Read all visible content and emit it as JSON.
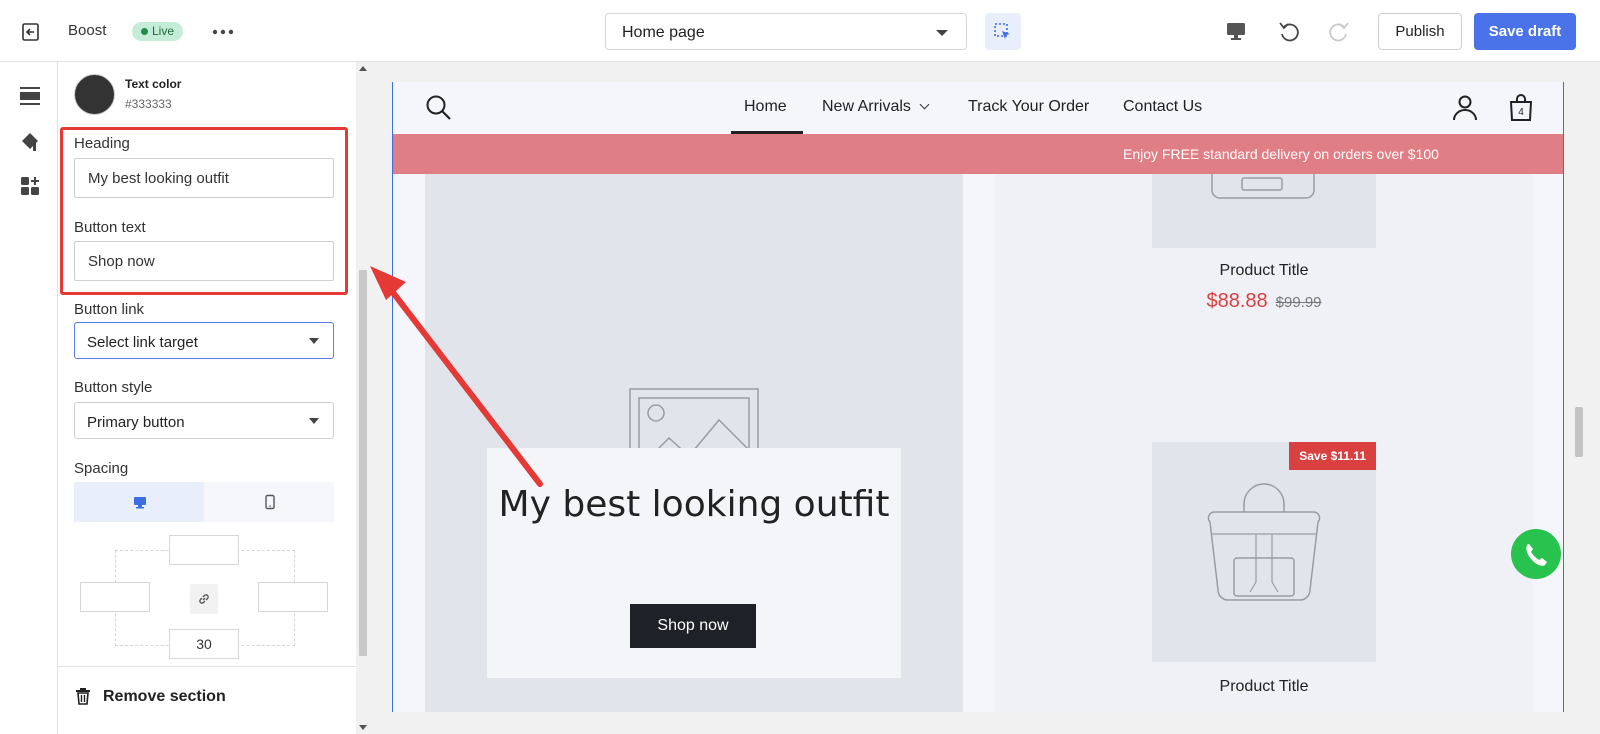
{
  "topbar": {
    "app_name": "Boost",
    "live_label": "Live",
    "page_select": "Home page",
    "publish_label": "Publish",
    "save_label": "Save draft"
  },
  "panel": {
    "text_color": {
      "title": "Text color",
      "value": "#333333"
    },
    "heading": {
      "label": "Heading",
      "value": "My best looking outfit"
    },
    "button_text": {
      "label": "Button text",
      "value": "Shop now"
    },
    "button_link": {
      "label": "Button link",
      "value": "Select link target"
    },
    "button_style": {
      "label": "Button style",
      "value": "Primary button"
    },
    "spacing": {
      "label": "Spacing",
      "top": "",
      "left": "",
      "right": "",
      "bottom": "30"
    },
    "remove_label": "Remove section"
  },
  "store": {
    "nav": [
      "Home",
      "New Arrivals",
      "Track Your Order",
      "Contact Us"
    ],
    "cart_count": "4",
    "promo": "Enjoy FREE standard delivery on orders over $100",
    "hero": {
      "heading": "My best looking outfit",
      "button": "Shop now"
    },
    "products": [
      {
        "title": "Product Title",
        "price": "$88.88",
        "compare_price": "$99.99"
      },
      {
        "title": "Product Title",
        "badge": "Save $11.11"
      }
    ]
  },
  "colors": {
    "accent": "#4a73ea",
    "promo_bar": "#e07e86",
    "sale": "#d94141",
    "highlight": "#e53935"
  }
}
